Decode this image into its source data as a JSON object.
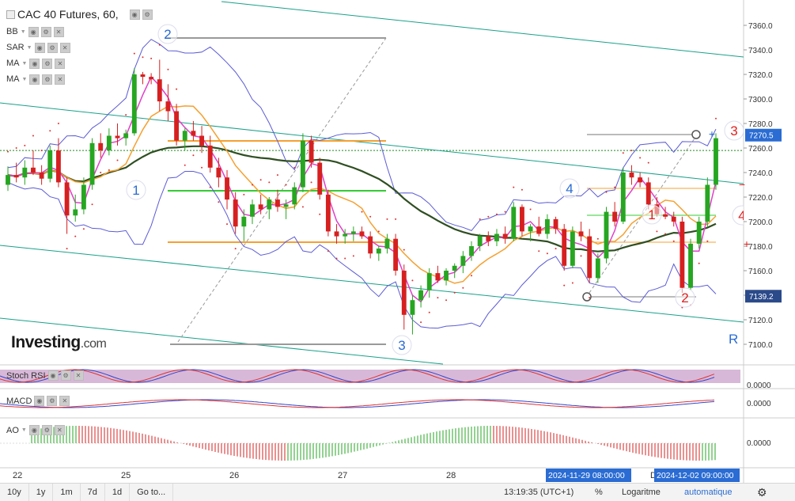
{
  "header": {
    "title": "CAC 40 Futures, 60,",
    "indicators": [
      "BB",
      "SAR",
      "MA",
      "MA"
    ]
  },
  "watermark": {
    "brand": "Investing",
    "suffix": ".com"
  },
  "price_axis": {
    "ticks": [
      "7360.0",
      "7340.0",
      "7320.0",
      "7300.0",
      "7280.0",
      "7260.0",
      "7240.0",
      "7220.0",
      "7200.0",
      "7180.0",
      "7160.0",
      "7140.0",
      "7120.0",
      "7100.0"
    ],
    "last_price_label": "7270.5",
    "low_price_label": "7139.2"
  },
  "time_axis": {
    "ticks": [
      "22",
      "25",
      "26",
      "27",
      "28",
      "D"
    ],
    "crosshair_left": "2024-11-29 08:00:00",
    "crosshair_right": "2024-12-02 09:00:00"
  },
  "panels": {
    "stoch": {
      "label": "Stoch RSI",
      "value": "0.0000"
    },
    "macd": {
      "label": "MACD",
      "value": "0.0000"
    },
    "ao": {
      "label": "AO",
      "value": "0.0000"
    }
  },
  "annotations": {
    "blue_numbers": [
      "1",
      "2",
      "3",
      "4"
    ],
    "red_numbers": [
      "1",
      "2",
      "3",
      "4"
    ],
    "r_marker": "R"
  },
  "toolbar": {
    "periods": [
      "10y",
      "1y",
      "1m",
      "7d",
      "1d",
      "Go to..."
    ],
    "clock": "13:19:35 (UTC+1)",
    "percent": "%",
    "log": "Logaritme",
    "auto": "automatique"
  },
  "colors": {
    "up": "#26a621",
    "down": "#d62020",
    "bb": "#5b5bd6",
    "ma_fast": "#e040c8",
    "ma_mid": "#f5a030",
    "ma_slow": "#2f4f22",
    "channel": "#19a08a",
    "sar": "#e03030",
    "accent": "#2a6cd3"
  },
  "chart_data": {
    "type": "candlestick",
    "title": "CAC 40 Futures, 60,",
    "ylim": [
      7090,
      7375
    ],
    "y_ticks": [
      7100,
      7120,
      7140,
      7160,
      7180,
      7200,
      7220,
      7240,
      7260,
      7280,
      7300,
      7320,
      7340,
      7360
    ],
    "last_price": 7270.5,
    "marked_low": 7139.2,
    "x_labels": [
      "22",
      "25",
      "26",
      "27",
      "28"
    ],
    "candles_ohlc": [
      [
        7230,
        7245,
        7225,
        7238
      ],
      [
        7238,
        7248,
        7232,
        7236
      ],
      [
        7236,
        7250,
        7230,
        7244
      ],
      [
        7244,
        7258,
        7238,
        7240
      ],
      [
        7240,
        7246,
        7230,
        7235
      ],
      [
        7235,
        7262,
        7232,
        7258
      ],
      [
        7258,
        7268,
        7228,
        7232
      ],
      [
        7232,
        7236,
        7190,
        7205
      ],
      [
        7205,
        7222,
        7200,
        7210
      ],
      [
        7210,
        7236,
        7206,
        7230
      ],
      [
        7230,
        7268,
        7226,
        7264
      ],
      [
        7264,
        7272,
        7252,
        7258
      ],
      [
        7258,
        7276,
        7254,
        7270
      ],
      [
        7270,
        7280,
        7262,
        7268
      ],
      [
        7268,
        7275,
        7262,
        7272
      ],
      [
        7272,
        7325,
        7270,
        7320
      ],
      [
        7320,
        7322,
        7312,
        7318
      ],
      [
        7318,
        7321,
        7312,
        7316
      ],
      [
        7316,
        7332,
        7290,
        7298
      ],
      [
        7298,
        7312,
        7282,
        7290
      ],
      [
        7290,
        7296,
        7262,
        7266
      ],
      [
        7266,
        7276,
        7258,
        7274
      ],
      [
        7274,
        7282,
        7266,
        7270
      ],
      [
        7270,
        7278,
        7256,
        7262
      ],
      [
        7262,
        7270,
        7240,
        7244
      ],
      [
        7244,
        7252,
        7228,
        7236
      ],
      [
        7236,
        7242,
        7210,
        7218
      ],
      [
        7218,
        7224,
        7190,
        7196
      ],
      [
        7196,
        7210,
        7184,
        7204
      ],
      [
        7204,
        7218,
        7198,
        7214
      ],
      [
        7214,
        7222,
        7206,
        7210
      ],
      [
        7210,
        7220,
        7202,
        7218
      ],
      [
        7218,
        7226,
        7208,
        7212
      ],
      [
        7212,
        7218,
        7202,
        7214
      ],
      [
        7214,
        7232,
        7210,
        7228
      ],
      [
        7228,
        7272,
        7224,
        7266
      ],
      [
        7266,
        7270,
        7244,
        7248
      ],
      [
        7248,
        7252,
        7218,
        7222
      ],
      [
        7222,
        7226,
        7188,
        7192
      ],
      [
        7192,
        7198,
        7182,
        7188
      ],
      [
        7188,
        7194,
        7182,
        7190
      ],
      [
        7190,
        7196,
        7184,
        7192
      ],
      [
        7192,
        7196,
        7186,
        7188
      ],
      [
        7188,
        7192,
        7170,
        7174
      ],
      [
        7174,
        7180,
        7168,
        7178
      ],
      [
        7178,
        7190,
        7174,
        7186
      ],
      [
        7186,
        7190,
        7156,
        7160
      ],
      [
        7160,
        7165,
        7112,
        7124
      ],
      [
        7124,
        7140,
        7108,
        7136
      ],
      [
        7136,
        7148,
        7130,
        7144
      ],
      [
        7144,
        7162,
        7138,
        7158
      ],
      [
        7158,
        7164,
        7150,
        7152
      ],
      [
        7152,
        7162,
        7148,
        7160
      ],
      [
        7160,
        7166,
        7154,
        7164
      ],
      [
        7164,
        7176,
        7158,
        7172
      ],
      [
        7172,
        7184,
        7168,
        7180
      ],
      [
        7180,
        7190,
        7176,
        7188
      ],
      [
        7188,
        7192,
        7180,
        7184
      ],
      [
        7184,
        7194,
        7180,
        7190
      ],
      [
        7190,
        7196,
        7182,
        7186
      ],
      [
        7186,
        7216,
        7184,
        7212
      ],
      [
        7212,
        7214,
        7188,
        7192
      ],
      [
        7192,
        7198,
        7184,
        7196
      ],
      [
        7196,
        7204,
        7188,
        7190
      ],
      [
        7190,
        7206,
        7186,
        7202
      ],
      [
        7202,
        7204,
        7190,
        7194
      ],
      [
        7194,
        7198,
        7160,
        7164
      ],
      [
        7164,
        7196,
        7162,
        7192
      ],
      [
        7192,
        7200,
        7184,
        7188
      ],
      [
        7188,
        7194,
        7150,
        7154
      ],
      [
        7154,
        7174,
        7150,
        7170
      ],
      [
        7170,
        7212,
        7166,
        7208
      ],
      [
        7208,
        7216,
        7196,
        7200
      ],
      [
        7200,
        7244,
        7198,
        7240
      ],
      [
        7240,
        7246,
        7230,
        7236
      ],
      [
        7236,
        7240,
        7228,
        7232
      ],
      [
        7232,
        7236,
        7210,
        7214
      ],
      [
        7214,
        7220,
        7204,
        7206
      ],
      [
        7206,
        7212,
        7202,
        7204
      ],
      [
        7204,
        7208,
        7196,
        7200
      ],
      [
        7200,
        7204,
        7142,
        7146
      ],
      [
        7146,
        7186,
        7144,
        7182
      ],
      [
        7182,
        7204,
        7178,
        7200
      ],
      [
        7200,
        7236,
        7196,
        7230
      ],
      [
        7230,
        7272,
        7226,
        7268
      ]
    ]
  }
}
